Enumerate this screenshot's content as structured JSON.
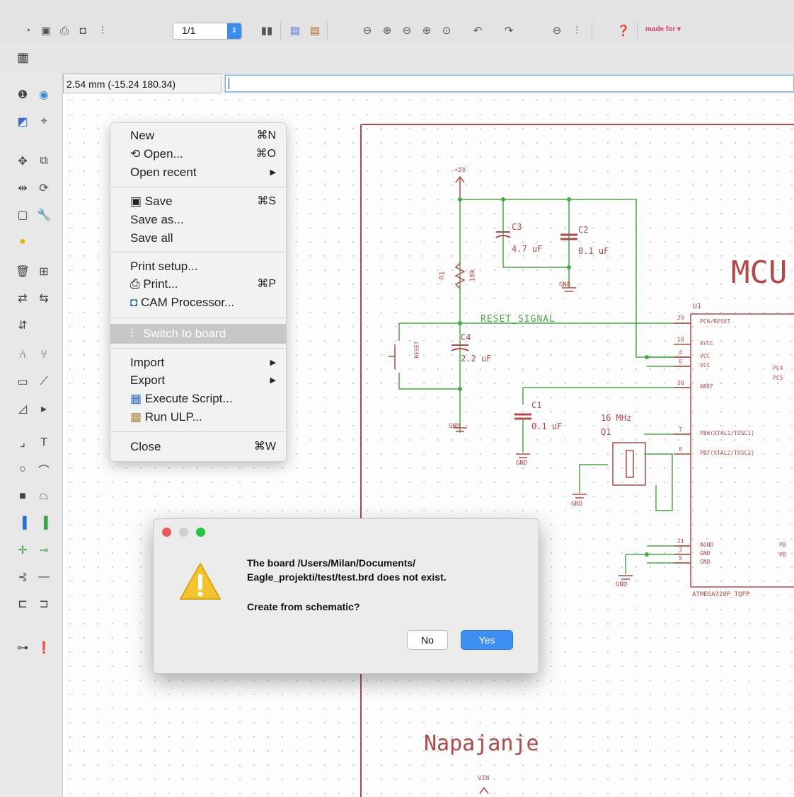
{
  "toolbar": {
    "sheet_value": "1/1",
    "logo_text": "made for"
  },
  "coord_display": "2.54 mm (-15.24 180.34)",
  "command_input": "",
  "file_menu": {
    "items": [
      {
        "label": "New",
        "shortcut": "⌘N"
      },
      {
        "label": "Open...",
        "shortcut": "⌘O"
      },
      {
        "label": "Open recent",
        "shortcut": "▶"
      },
      {
        "label": "Save",
        "shortcut": "⌘S"
      },
      {
        "label": "Save as...",
        "shortcut": ""
      },
      {
        "label": "Save all",
        "shortcut": ""
      },
      {
        "label": "Print setup...",
        "shortcut": ""
      },
      {
        "label": "Print...",
        "shortcut": "⌘P"
      },
      {
        "label": "CAM Processor...",
        "shortcut": ""
      },
      {
        "label": "Switch to board",
        "shortcut": ""
      },
      {
        "label": "Import",
        "shortcut": "▶"
      },
      {
        "label": "Export",
        "shortcut": "▶"
      },
      {
        "label": "Execute Script...",
        "shortcut": ""
      },
      {
        "label": "Run ULP...",
        "shortcut": ""
      },
      {
        "label": "Close",
        "shortcut": "⌘W"
      }
    ]
  },
  "dialog": {
    "message_line1": "The board /Users/Milan/Documents/",
    "message_line2": "Eagle_projekti/test/test.brd does not exist.",
    "question": "Create from schematic?",
    "no_label": "No",
    "yes_label": "Yes"
  },
  "schematic": {
    "mcu_title": "MCU",
    "section_title": "Napajanje",
    "supply_label": "+5V",
    "vin_label": "VIN",
    "reset_net": "RESET_SIGNAL",
    "c3": {
      "name": "C3",
      "value": "4.7 uF"
    },
    "c2": {
      "name": "C2",
      "value": "0.1 uF"
    },
    "c4": {
      "name": "C4",
      "value": "2.2 uF"
    },
    "c1": {
      "name": "C1",
      "value": "0.1 uF"
    },
    "r1": {
      "name": "R1",
      "value": "10k"
    },
    "crystal": {
      "name": "Q1",
      "value": "16 MHz"
    },
    "reset_button": "RESET",
    "gnd": "GND",
    "u1_name": "U1",
    "u1_part": "ATMEGA328P_TQFP",
    "pins": [
      {
        "num": "29",
        "name": "PC6/RESET"
      },
      {
        "num": "18",
        "name": "AVCC"
      },
      {
        "num": "4",
        "name": "VCC"
      },
      {
        "num": "6",
        "name": "VCC"
      },
      {
        "num": "20",
        "name": "AREF"
      },
      {
        "num": "7",
        "name": "PB6(XTAL1/TOSC1)"
      },
      {
        "num": "8",
        "name": "PB7(XTAL2/TOSC2)"
      },
      {
        "num": "21",
        "name": "AGND"
      },
      {
        "num": "3",
        "name": "GND"
      },
      {
        "num": "5",
        "name": "GND"
      }
    ],
    "right_pins": [
      "PC4",
      "PC5",
      "PB",
      "PB"
    ]
  }
}
